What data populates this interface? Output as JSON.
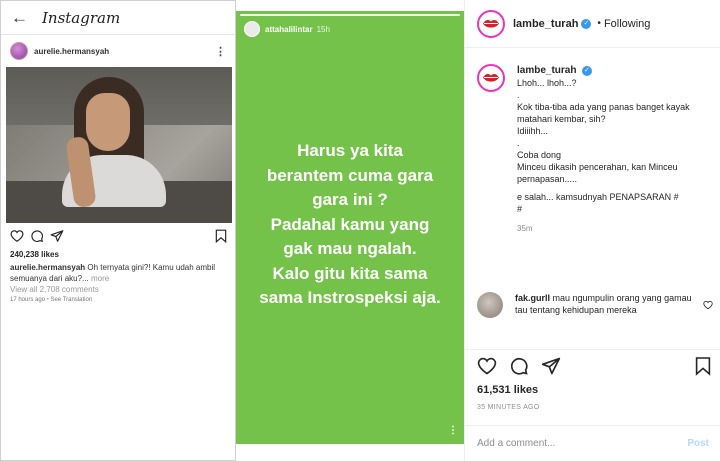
{
  "left_post": {
    "brand": "Instagram",
    "back_icon": "arrow-left-icon",
    "username": "aurelie.hermansyah",
    "likes": "240,238 likes",
    "caption_user": "aurelie.hermansyah",
    "caption_text": "Oh ternyata gini?! Kamu udah ambil semuanya dari aku?...",
    "caption_more": "more",
    "view_comments": "View all 2,708 comments",
    "time_ago": "17 hours ago",
    "see_translation": "See Translation"
  },
  "story": {
    "username": "attahalilintar",
    "time": "15h",
    "lines": [
      "Harus ya kita",
      "berantem cuma gara",
      "gara ini ?",
      "Padahal kamu yang",
      "gak mau ngalah.",
      "Kalo gitu kita sama",
      "sama Instrospeksi aja."
    ],
    "background_color": "#74c24a"
  },
  "right_post": {
    "header": {
      "username": "lambe_turah",
      "dot": "•",
      "follow_status": "Following"
    },
    "caption": {
      "username": "lambe_turah",
      "lines": [
        "Lhoh... lhoh...?",
        ".",
        "Kok tiba-tiba ada yang panas banget kayak matahari kembar, sih?",
        "Idiiihh...",
        ".",
        "Coba dong",
        "Minceu dikasih pencerahan, kan Minceu pernapasan.....",
        "",
        "e salah... kamsudnyah PENAPSARAN #",
        "#"
      ],
      "age": "35m"
    },
    "comment": {
      "username": "fak.gurll",
      "text": "mau ngumpulin orang yang gamau tau tentang kehidupan mereka"
    },
    "likes": "61,531 likes",
    "time_ago": "35 MINUTES AGO",
    "add_comment_placeholder": "Add a comment...",
    "post_label": "Post",
    "accent_color": "#3897f0"
  }
}
